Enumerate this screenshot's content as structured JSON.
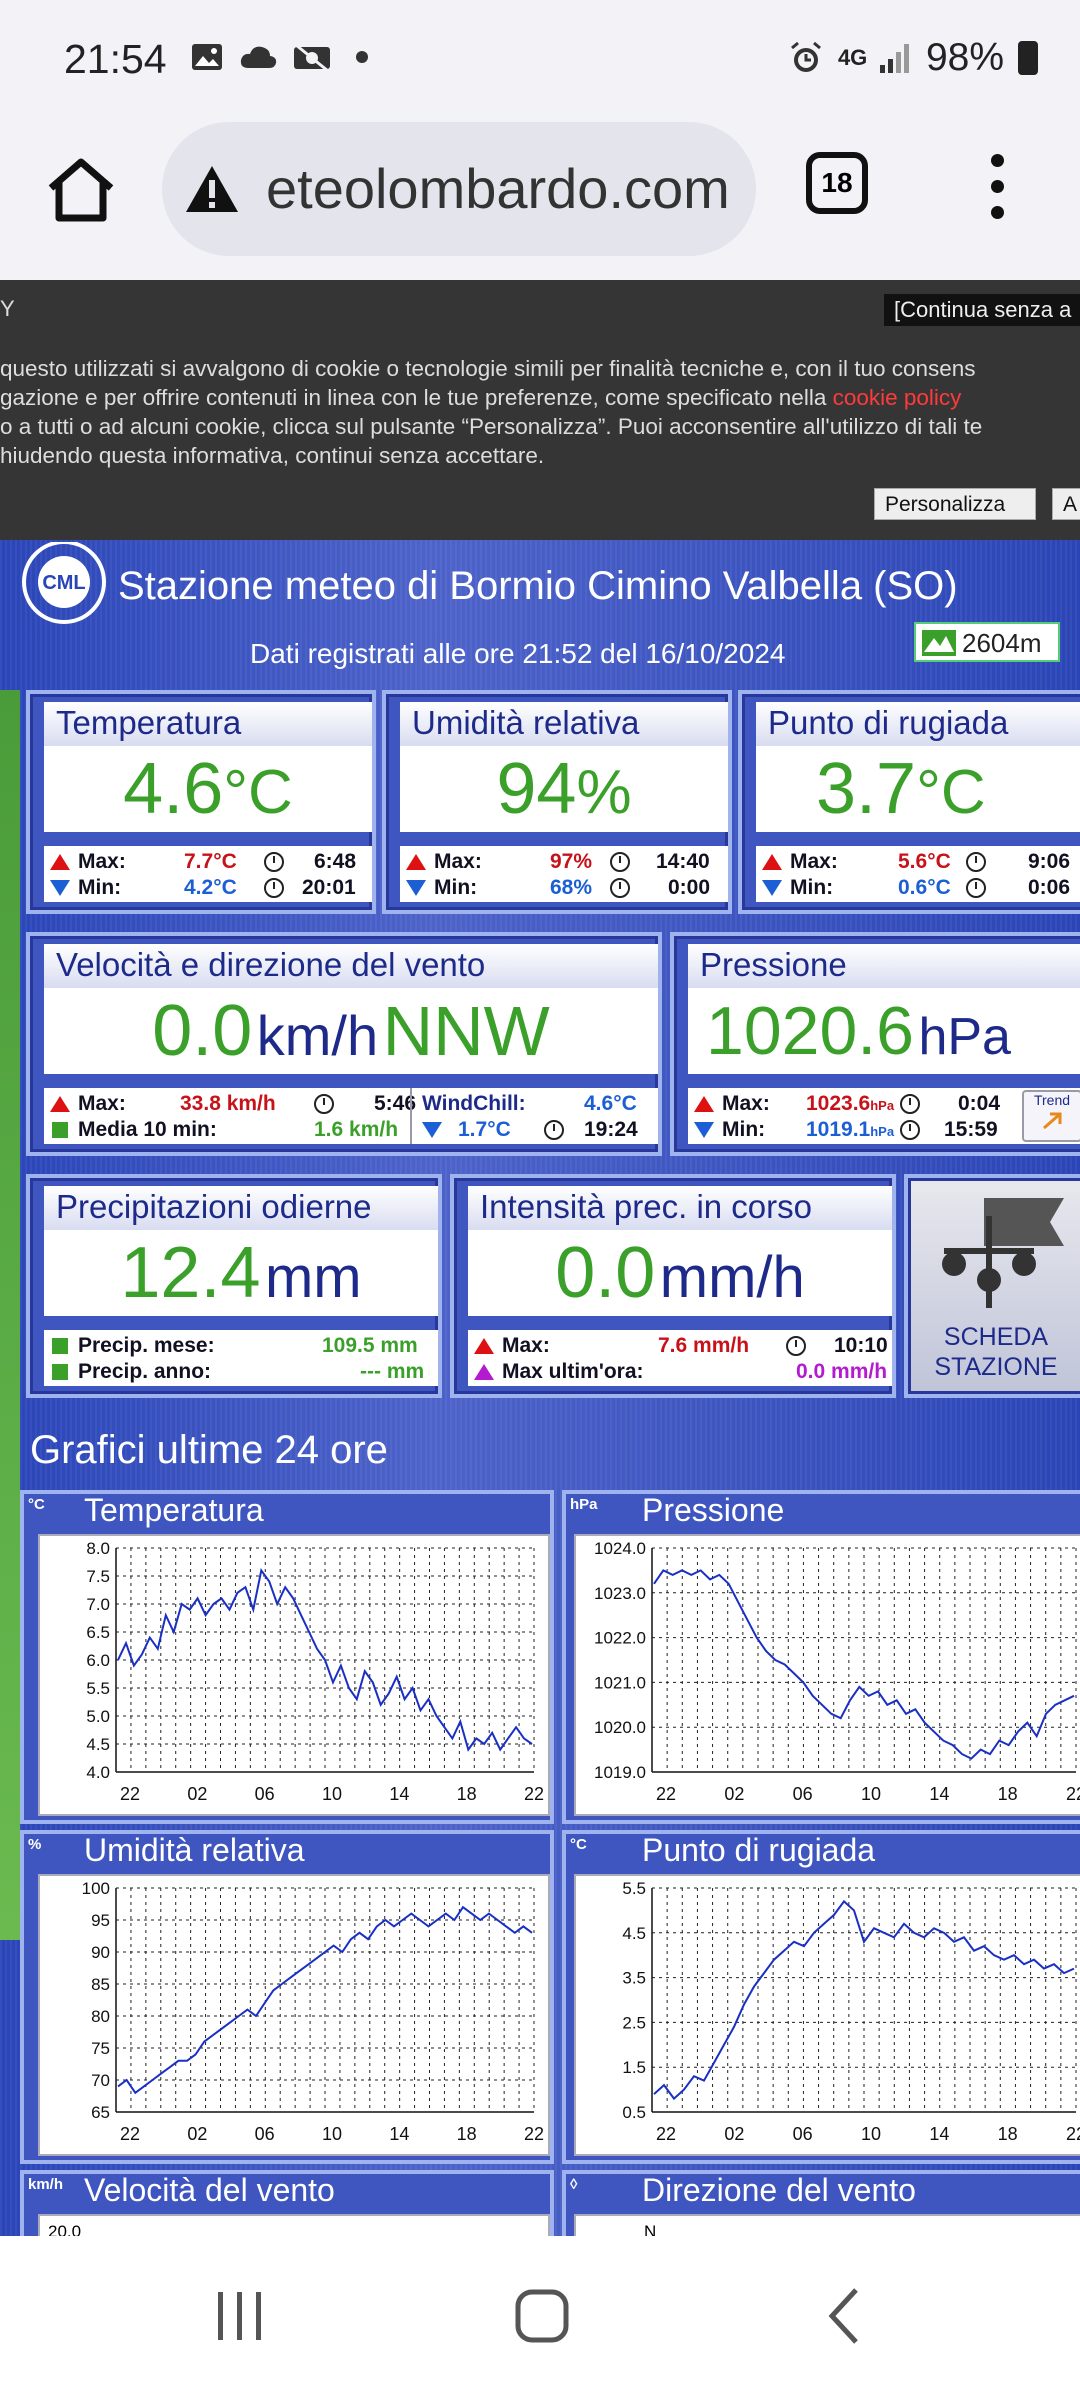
{
  "status": {
    "time": "21:54",
    "network": "4G",
    "battery": "98%"
  },
  "browser": {
    "url": "eteolombardo.com",
    "tabs": "18"
  },
  "cookie": {
    "title_fragment": "Y",
    "continue": "[Continua senza a",
    "lines": [
      " questo utilizzati si avvalgono di cookie o tecnologie simili per finalità tecniche e, con il tuo consens",
      "gazione e per offrire contenuti in linea con le tue preferenze, come specificato nella ",
      "o a tutti o ad alcuni cookie, clicca sul pulsante “Personalizza”. Puoi acconsentire all'utilizzo di tali te",
      "hiudendo questa informativa, continui senza accettare."
    ],
    "link": "cookie policy",
    "personalizza": "Personalizza",
    "accept": "A"
  },
  "station": {
    "logo_text": "CML",
    "title": "Stazione meteo di Bormio Cimino Valbella (SO)",
    "recorded": "Dati registrati alle ore 21:52 del 16/10/2024",
    "altitude": "2604m"
  },
  "temperatura": {
    "title": "Temperatura",
    "value": "4.6",
    "unit": "°C",
    "max_label": "Max:",
    "max": "7.7°C",
    "max_time": "6:48",
    "min_label": "Min:",
    "min": "4.2°C",
    "min_time": "20:01"
  },
  "umidita": {
    "title": "Umidità relativa",
    "value": "94",
    "unit": "%",
    "max_label": "Max:",
    "max": "97%",
    "max_time": "14:40",
    "min_label": "Min:",
    "min": "68%",
    "min_time": "0:00"
  },
  "rugiada": {
    "title": "Punto di rugiada",
    "value": "3.7",
    "unit": "°C",
    "max_label": "Max:",
    "max": "5.6°C",
    "max_time": "9:06",
    "min_label": "Min:",
    "min": "0.6°C",
    "min_time": "0:06"
  },
  "vento": {
    "title": "Velocità e direzione del vento",
    "value": "0.0",
    "unit": "km/h",
    "dir": "NNW",
    "max_label": "Max:",
    "max": "33.8 km/h",
    "max_time": "5:46",
    "media_label": "Media 10 min:",
    "media": "1.6 km/h",
    "wc_label": "WindChill:",
    "wc": "4.6°C",
    "wc_min": "1.7°C",
    "wc_time": "19:24"
  },
  "pressione": {
    "title": "Pressione",
    "value": "1020.6",
    "unit": "hPa",
    "max_label": "Max:",
    "max": "1023.6",
    "max_unit": "hPa",
    "max_time": "0:04",
    "min_label": "Min:",
    "min": "1019.1",
    "min_unit": "hPa",
    "min_time": "15:59",
    "trend": "Trend"
  },
  "precip": {
    "title": "Precipitazioni odierne",
    "value": "12.4",
    "unit": "mm",
    "mese_label": "Precip. mese:",
    "mese": "109.5 mm",
    "anno_label": "Precip. anno:",
    "anno": "--- mm"
  },
  "intensita": {
    "title": "Intensità prec. in corso",
    "value": "0.0",
    "unit": "mm/h",
    "max_label": "Max:",
    "max": "7.6 mm/h",
    "max_time": "10:10",
    "ora_label": "Max ultim'ora:",
    "ora": "0.0 mm/h"
  },
  "scheda": {
    "line1": "SCHEDA",
    "line2": "STAZIONE"
  },
  "graphs_title": "Grafici ultime 24 ore",
  "chart_data": [
    {
      "type": "line",
      "title": "Temperatura",
      "unit_label": "°C",
      "x_ticks": [
        "22",
        "02",
        "06",
        "10",
        "14",
        "18",
        "22"
      ],
      "y_ticks": [
        "8.0",
        "7.5",
        "7.0",
        "6.5",
        "6.0",
        "5.5",
        "5.0",
        "4.5",
        "4.0"
      ],
      "ylim": [
        4.0,
        8.0
      ],
      "y": [
        6.0,
        6.3,
        5.9,
        6.1,
        6.4,
        6.2,
        6.8,
        6.5,
        7.0,
        6.9,
        7.1,
        6.8,
        7.0,
        7.1,
        6.9,
        7.2,
        7.3,
        6.9,
        7.6,
        7.4,
        7.0,
        7.3,
        7.1,
        6.8,
        6.5,
        6.2,
        6.0,
        5.6,
        5.9,
        5.5,
        5.3,
        5.8,
        5.6,
        5.2,
        5.4,
        5.7,
        5.3,
        5.5,
        5.1,
        5.3,
        5.0,
        4.8,
        4.6,
        4.9,
        4.4,
        4.6,
        4.5,
        4.7,
        4.4,
        4.6,
        4.8,
        4.6,
        4.5
      ]
    },
    {
      "type": "line",
      "title": "Pressione",
      "unit_label": "hPa",
      "x_ticks": [
        "22",
        "02",
        "06",
        "10",
        "14",
        "18",
        "22"
      ],
      "y_ticks": [
        "1024.0",
        "1023.0",
        "1022.0",
        "1021.0",
        "1020.0",
        "1019.0"
      ],
      "ylim": [
        1019.0,
        1024.0
      ],
      "y": [
        1023.2,
        1023.5,
        1023.4,
        1023.5,
        1023.4,
        1023.5,
        1023.3,
        1023.4,
        1023.2,
        1022.8,
        1022.4,
        1022.0,
        1021.7,
        1021.5,
        1021.4,
        1021.2,
        1021.0,
        1020.7,
        1020.5,
        1020.3,
        1020.2,
        1020.6,
        1020.9,
        1020.7,
        1020.8,
        1020.5,
        1020.6,
        1020.3,
        1020.4,
        1020.1,
        1019.9,
        1019.7,
        1019.6,
        1019.4,
        1019.3,
        1019.5,
        1019.4,
        1019.7,
        1019.6,
        1019.9,
        1020.1,
        1019.8,
        1020.3,
        1020.5,
        1020.6,
        1020.7
      ]
    },
    {
      "type": "line",
      "title": "Umidità relativa",
      "unit_label": "%",
      "x_ticks": [
        "22",
        "02",
        "06",
        "10",
        "14",
        "18",
        "22"
      ],
      "y_ticks": [
        "100",
        "95",
        "90",
        "85",
        "80",
        "75",
        "70",
        "65"
      ],
      "ylim": [
        65,
        100
      ],
      "y": [
        69,
        70,
        68,
        69,
        70,
        71,
        72,
        73,
        73,
        74,
        76,
        77,
        78,
        79,
        80,
        81,
        80,
        82,
        84,
        85,
        86,
        87,
        88,
        89,
        90,
        91,
        90,
        92,
        93,
        92,
        94,
        95,
        94,
        95,
        96,
        95,
        94,
        95,
        96,
        95,
        97,
        96,
        95,
        96,
        95,
        94,
        93,
        94,
        93
      ]
    },
    {
      "type": "line",
      "title": "Punto di rugiada",
      "unit_label": "°C",
      "x_ticks": [
        "22",
        "02",
        "06",
        "10",
        "14",
        "18",
        "22"
      ],
      "y_ticks": [
        "5.5",
        "4.5",
        "3.5",
        "2.5",
        "1.5",
        "0.5"
      ],
      "ylim": [
        0.5,
        5.5
      ],
      "y": [
        0.9,
        1.1,
        0.8,
        1.0,
        1.3,
        1.2,
        1.6,
        2.0,
        2.4,
        2.9,
        3.3,
        3.6,
        3.9,
        4.1,
        4.3,
        4.2,
        4.5,
        4.7,
        4.9,
        5.2,
        5.0,
        4.3,
        4.6,
        4.5,
        4.4,
        4.7,
        4.5,
        4.4,
        4.6,
        4.5,
        4.3,
        4.4,
        4.1,
        4.2,
        4.0,
        3.9,
        4.0,
        3.8,
        3.9,
        3.7,
        3.8,
        3.6,
        3.7
      ]
    },
    {
      "type": "line",
      "title": "Velocità del vento",
      "unit_label": "km/h",
      "x_ticks": [],
      "y_ticks": [
        "20.0"
      ],
      "ylim": [
        0,
        20
      ],
      "y": []
    },
    {
      "type": "line",
      "title": "Direzione del vento",
      "unit_label": "◊",
      "x_ticks": [],
      "y_ticks": [
        "N"
      ],
      "ylim": [
        0,
        360
      ],
      "y": []
    }
  ]
}
